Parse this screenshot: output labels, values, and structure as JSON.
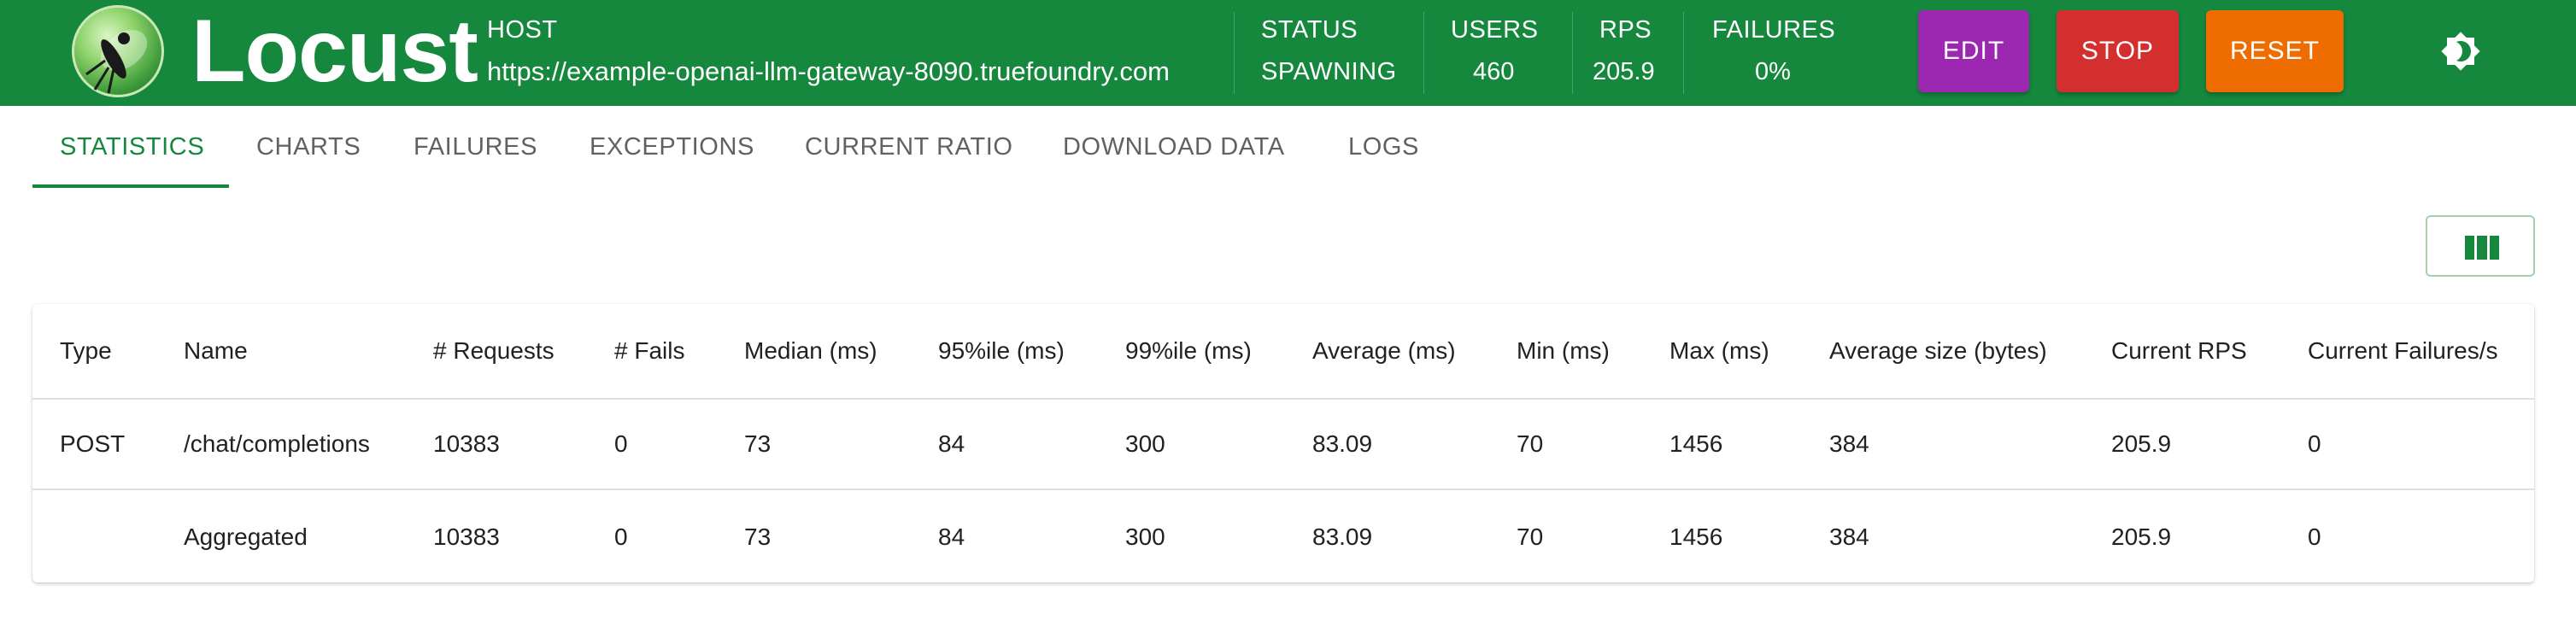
{
  "header": {
    "brand": "Locust",
    "host_label": "HOST",
    "host_value": "https://example-openai-llm-gateway-8090.truefoundry.com",
    "stats": [
      {
        "label": "STATUS",
        "value": "SPAWNING"
      },
      {
        "label": "USERS",
        "value": "460"
      },
      {
        "label": "RPS",
        "value": "205.9"
      },
      {
        "label": "FAILURES",
        "value": "0%"
      }
    ],
    "buttons": {
      "edit": "EDIT",
      "stop": "STOP",
      "reset": "RESET"
    },
    "theme_icon": "brightness-icon",
    "colors": {
      "header_bg": "#15883e",
      "edit": "#9c27b0",
      "stop": "#d32f2f",
      "reset": "#ef6c00"
    }
  },
  "tabs": [
    {
      "label": "STATISTICS",
      "active": true
    },
    {
      "label": "CHARTS",
      "active": false
    },
    {
      "label": "FAILURES",
      "active": false
    },
    {
      "label": "EXCEPTIONS",
      "active": false
    },
    {
      "label": "CURRENT RATIO",
      "active": false
    },
    {
      "label": "DOWNLOAD DATA",
      "active": false
    },
    {
      "label": "LOGS",
      "active": false
    }
  ],
  "columns_button_icon": "view-columns-icon",
  "table": {
    "columns": [
      "Type",
      "Name",
      "# Requests",
      "# Fails",
      "Median (ms)",
      "95%ile (ms)",
      "99%ile (ms)",
      "Average (ms)",
      "Min (ms)",
      "Max (ms)",
      "Average size (bytes)",
      "Current RPS",
      "Current Failures/s"
    ],
    "rows": [
      [
        "POST",
        "/chat/completions",
        "10383",
        "0",
        "73",
        "84",
        "300",
        "83.09",
        "70",
        "1456",
        "384",
        "205.9",
        "0"
      ],
      [
        "",
        "Aggregated",
        "10383",
        "0",
        "73",
        "84",
        "300",
        "83.09",
        "70",
        "1456",
        "384",
        "205.9",
        "0"
      ]
    ]
  }
}
